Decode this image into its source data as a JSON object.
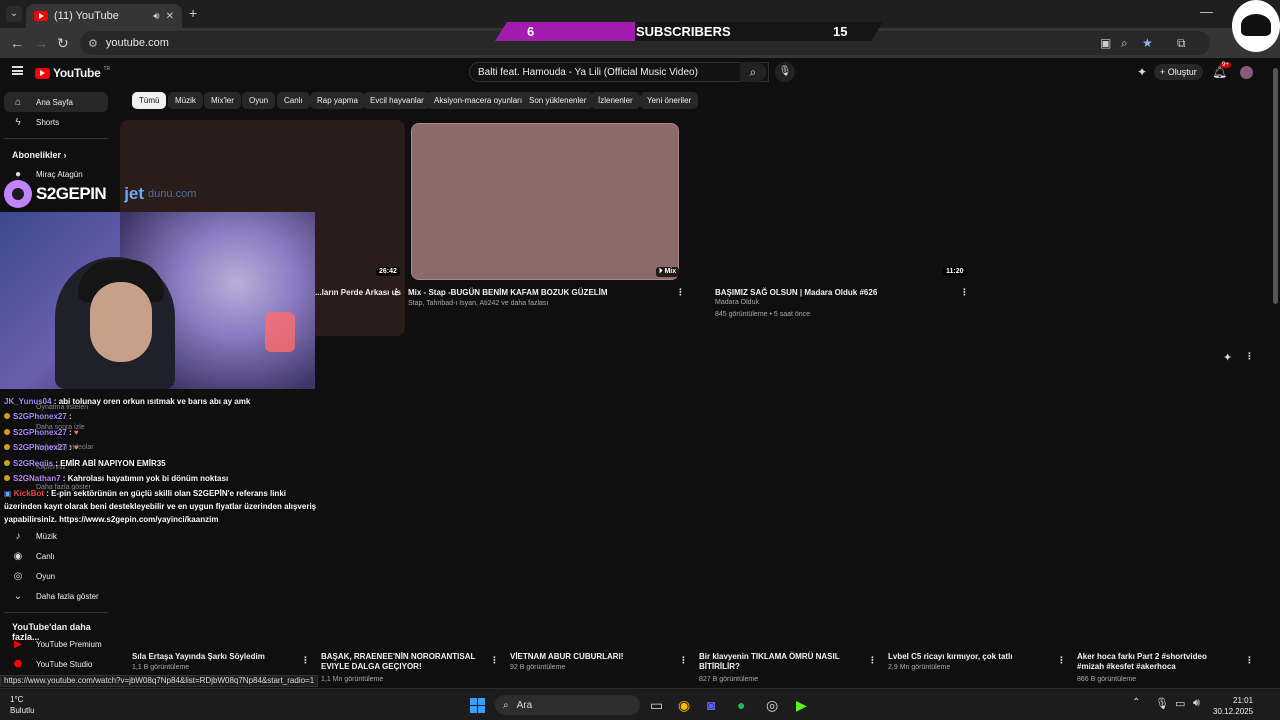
{
  "browser": {
    "tab_title": "(11) YouTube",
    "url": "youtube.com"
  },
  "overlay": {
    "left_count": "6",
    "label": "SUBSCRIBERS",
    "right_count": "15",
    "brand": "S2GEPIN",
    "sponsor": "jet",
    "sponsor_suffix": "dunu.com"
  },
  "youtube": {
    "logo_text": "YouTube",
    "region": "TR",
    "search_query": "Balti feat. Hamouda - Ya Lili (Official Music Video)",
    "create_label": "Oluştur",
    "notif_badge": "9+"
  },
  "sidebar": {
    "home": "Ana Sayfa",
    "shorts": "Shorts",
    "subscriptions": "Abonelikler",
    "sub_channel": "Miraç Atagün",
    "music": "Müzik",
    "live": "Canlı",
    "gaming": "Oyun",
    "show_more": "Daha fazla göster",
    "more_from_yt": "YouTube'dan daha fazla...",
    "premium": "YouTube Premium",
    "studio": "YouTube Studio"
  },
  "chips": [
    "Tümü",
    "Müzik",
    "Mix'ler",
    "Oyun",
    "Canlı",
    "Rap yapma",
    "Evcil hayvanlar",
    "Aksiyon-macera oyunları",
    "Son yüklenenler",
    "İzlenenler",
    "Yeni öneriler"
  ],
  "videos": [
    {
      "title": "...ların Perde Arkası us",
      "duration": "26:42",
      "thumb_color": "#2a1c18"
    },
    {
      "title": "Mix - Stap -BUGÜN BENİM KAFAM BOZUK GÜZELİM",
      "meta": "Stap, Tahribad-ı İsyan, Ati242 ve daha fazlası",
      "duration": "Mix",
      "thumb_color": "#8c6a6a"
    },
    {
      "title": "BAŞIMIZ SAĞ OLSUN | Madara Olduk #626",
      "channel": "Madara Olduk",
      "meta": "845 görüntüleme • 5 saat önce",
      "duration": "11:20",
      "thumb_color": "#0f0f0f"
    }
  ],
  "shorts_row": [
    {
      "title": "Sıla Ertaşa Yayında Şarkı Söyledim",
      "views": "1,1 B görüntüleme"
    },
    {
      "title": "BAŞAK, RRAENEE'NİN NORORANTISAL EVIYLE DALGA GEÇIYOR!",
      "views": "1,1 Mn görüntüleme"
    },
    {
      "title": "VİETNAM ABUR CUBURLARI!",
      "views": "92 B görüntüleme"
    },
    {
      "title": "Bir klavyenin TIKLAMA ÖMRÜ NASIL BİTİRİLİR?",
      "views": "827 B görüntüleme"
    },
    {
      "title": "Lvbel C5 ricayı kırmıyor, çok tatlı",
      "views": "2,9 Mn görüntüleme"
    },
    {
      "title": "Aker hoca farkı Part 2 #shortvideo #mizah #kesfet #akerhoca",
      "views": "866 B görüntüleme"
    }
  ],
  "chat": [
    {
      "user": "JK_Yunus04",
      "msg": "abi tolunay oren orkun ısıtmak ve barıs abı ay amk"
    },
    {
      "user": "S2GPhonex27",
      "msg": ""
    },
    {
      "user": "S2GPhonex27",
      "msg": ""
    },
    {
      "user": "S2GPhonex27",
      "msg": ""
    },
    {
      "user": "S2GReqiis",
      "msg": "EMİR ABİ NAPIYON EMİR35"
    },
    {
      "user": "S2GNathan7",
      "msg": "Kahrolası hayatımın yok bi dönüm noktası"
    },
    {
      "user": "KickBot",
      "msg": "E-pin sektörünün en güçlü skilli olan S2GEPİN'e referans linki"
    },
    {
      "user": "",
      "msg": "üzerinden kayıt olarak beni destekleyebilir ve en uygun fiyatlar üzerinden alışveriş"
    },
    {
      "user": "",
      "msg": "yapabilirsiniz. https://www.s2gepin.com/yayinci/kaanzim"
    }
  ],
  "ghost_text": [
    "Oynatma listeleri",
    "Daha sonra izle",
    "Beğenilen videolar",
    "Klipleriniz",
    "Daha fazla göster"
  ],
  "status_url": "https://www.youtube.com/watch?v=jbW08q7Np84&list=RDjbW08q7Np84&start_radio=1",
  "taskbar": {
    "temp": "1°C",
    "weather": "Bulutlu",
    "search": "Ara",
    "time": "21:01",
    "date": "30.12.2025"
  }
}
